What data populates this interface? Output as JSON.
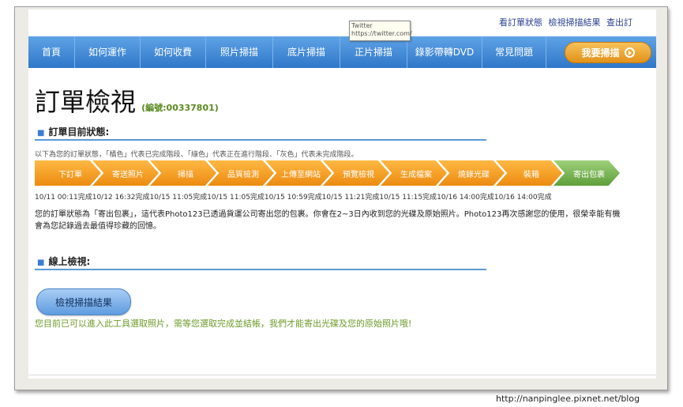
{
  "top_links": [
    "看訂單狀態",
    "檢視掃描結果",
    "查出訂"
  ],
  "tooltip": {
    "title": "Twitter",
    "url": "https://twitter.com/"
  },
  "nav": {
    "items": [
      "首頁",
      "如何運作",
      "如何收費",
      "照片掃描",
      "底片掃描",
      "正片掃描",
      "錄影帶轉DVD",
      "常見問題"
    ],
    "cta": "我要掃描"
  },
  "title": {
    "main": "訂單檢視",
    "order_no": "(編號:00337801)"
  },
  "status_section": {
    "heading": "訂單目前狀態:",
    "legend": "以下為您的訂單狀態，「橘色」代表已完成階段、「綠色」代表正在進行階段、「灰色」代表未完成階段。",
    "steps": [
      {
        "label": "下訂單",
        "state": "done"
      },
      {
        "label": "寄送照片",
        "state": "done"
      },
      {
        "label": "掃描",
        "state": "done"
      },
      {
        "label": "品質檢測",
        "state": "done"
      },
      {
        "label": "上傳至網站",
        "state": "done"
      },
      {
        "label": "預覽檢視",
        "state": "done"
      },
      {
        "label": "生成檔案",
        "state": "done"
      },
      {
        "label": "燒錄光碟",
        "state": "done"
      },
      {
        "label": "裝箱",
        "state": "done"
      },
      {
        "label": "寄出包裹",
        "state": "current"
      }
    ],
    "timestamps": "10/11 00:11完成10/12 16:32完成10/15 11:05完成10/15 11:05完成10/15 10:59完成10/15 11:21完成10/15 11:15完成10/16 14:00完成10/16 14:00完成",
    "message": "您的訂單狀態為「寄出包裹」，這代表Photo123已透過貨運公司寄出您的包裹。你會在2~3日內收到您的光碟及原始照片。Photo123再次感謝您的使用，很榮幸能有機會為您記錄過去最值得珍藏的回憶。"
  },
  "online_section": {
    "heading": "線上檢視:",
    "button": "檢視掃描結果",
    "note": "您目前已可以進入此工具選取照片，需等您選取完成並結帳，我們才能寄出光碟及您的原始照片哦!"
  },
  "watermark": "http://nanpinglee.pixnet.net/blog",
  "colors": {
    "nav_blue": "#2f77c9",
    "done_orange": "#ec8a10",
    "current_green": "#5e9e3a",
    "accent_text_green": "#6f9a2a"
  }
}
